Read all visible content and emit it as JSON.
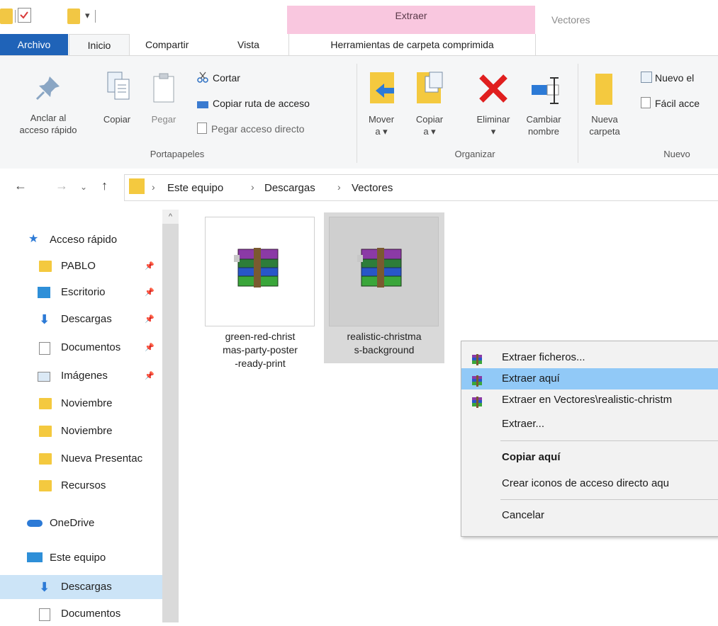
{
  "titlebar": {
    "context_tab": "Extraer",
    "window_title": "Vectores"
  },
  "tabs": {
    "archivo": "Archivo",
    "inicio": "Inicio",
    "compartir": "Compartir",
    "vista": "Vista",
    "herramientas": "Herramientas de carpeta comprimida"
  },
  "ribbon": {
    "portapapeles": {
      "anclar": [
        "Anclar al",
        "acceso rápido"
      ],
      "copiar": "Copiar",
      "pegar": "Pegar",
      "cortar": "Cortar",
      "copiar_ruta": "Copiar ruta de acceso",
      "pegar_acceso": "Pegar acceso directo",
      "group": "Portapapeles"
    },
    "organizar": {
      "mover": [
        "Mover",
        "a ▾"
      ],
      "copiar": [
        "Copiar",
        "a ▾"
      ],
      "eliminar": [
        "Eliminar",
        "▾"
      ],
      "cambiar": [
        "Cambiar",
        "nombre"
      ],
      "group": "Organizar"
    },
    "nuevo": {
      "nueva_carpeta": [
        "Nueva",
        "carpeta"
      ],
      "nuevo_el": "Nuevo el",
      "facil": "Fácil acce",
      "group": "Nuevo"
    }
  },
  "address": {
    "crumbs": [
      "Este equipo",
      "Descargas",
      "Vectores"
    ]
  },
  "nav": {
    "acceso_rapido": "Acceso rápido",
    "items": [
      {
        "label": "PABLO",
        "icon": "folder-icon",
        "pinned": true
      },
      {
        "label": "Escritorio",
        "icon": "desktop-icon",
        "pinned": true
      },
      {
        "label": "Descargas",
        "icon": "download-icon",
        "pinned": true
      },
      {
        "label": "Documentos",
        "icon": "documents-icon",
        "pinned": true
      },
      {
        "label": "Imágenes",
        "icon": "pictures-icon",
        "pinned": true
      },
      {
        "label": "Noviembre",
        "icon": "folder-icon",
        "pinned": false
      },
      {
        "label": "Noviembre",
        "icon": "folder-icon",
        "pinned": false
      },
      {
        "label": "Nueva Presentac",
        "icon": "folder-icon",
        "pinned": false
      },
      {
        "label": "Recursos",
        "icon": "folder-icon",
        "pinned": false
      }
    ],
    "onedrive": "OneDrive",
    "este_equipo": "Este equipo",
    "sub": [
      {
        "label": "Descargas",
        "icon": "download-icon",
        "selected": true
      },
      {
        "label": "Documentos",
        "icon": "documents-icon",
        "selected": false
      }
    ]
  },
  "files": [
    {
      "name": "green-red-christmas-party-poster-ready-print",
      "lines": [
        "green-red-christ",
        "mas-party-poster",
        "-ready-print"
      ],
      "selected": false
    },
    {
      "name": "realistic-christmas-background",
      "lines": [
        "realistic-christma",
        "s-background"
      ],
      "selected": true
    }
  ],
  "context_menu": {
    "items": [
      {
        "label": "Extraer ficheros...",
        "icon": "winrar-icon"
      },
      {
        "label": "Extraer aquí",
        "icon": "winrar-icon",
        "hover": true
      },
      {
        "label": "Extraer en Vectores\\realistic-christm",
        "icon": "winrar-icon"
      },
      {
        "label": "Extraer..."
      },
      {
        "label": "Copiar aquí",
        "bold": true
      },
      {
        "label": "Crear iconos de acceso directo aqu"
      },
      {
        "label": "Cancelar"
      }
    ]
  },
  "colors": {
    "archivo_tab": "#1f63b8",
    "context_header": "#f9c7df",
    "selection": "#cce4f7",
    "menu_hover": "#91c9f7"
  }
}
